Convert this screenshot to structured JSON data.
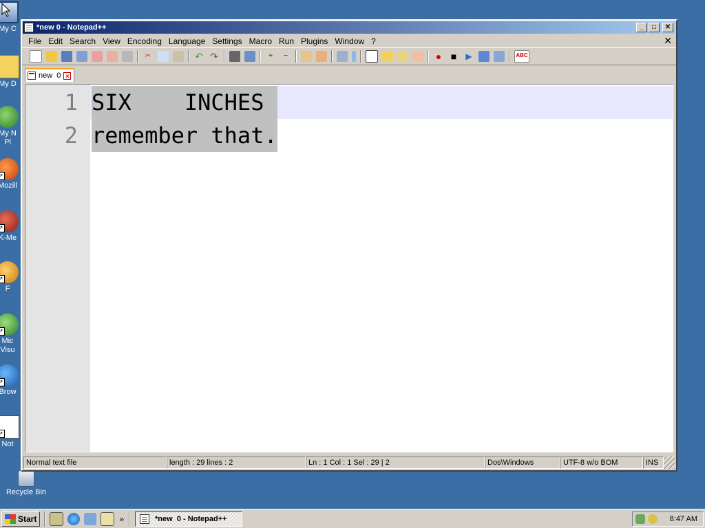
{
  "desktop": {
    "icons": [
      {
        "label": "My C",
        "icon": "my-computer-icon"
      },
      {
        "label": "My D",
        "icon": "my-documents-icon"
      },
      {
        "label": "My N\nPl",
        "icon": "network-places-icon"
      },
      {
        "label": "Mozill",
        "icon": "mozilla-icon"
      },
      {
        "label": "K-Me",
        "icon": "k-meleon-icon"
      },
      {
        "label": "F",
        "icon": "app-icon"
      },
      {
        "label": "Mic\nVisu",
        "icon": "visual-app-icon"
      },
      {
        "label": "Brow",
        "icon": "browser-icon"
      },
      {
        "label": "Not",
        "icon": "notepad-icon"
      },
      {
        "label": "Recycle Bin",
        "icon": "recycle-bin-icon"
      }
    ]
  },
  "window": {
    "title": "*new  0 - Notepad++",
    "controls": {
      "minimize": "_",
      "maximize": "□",
      "close": "✕"
    }
  },
  "menu": {
    "items": [
      "File",
      "Edit",
      "Search",
      "View",
      "Encoding",
      "Language",
      "Settings",
      "Macro",
      "Run",
      "Plugins",
      "Window",
      "?"
    ],
    "close_doc": "✕"
  },
  "toolbar": {
    "buttons": [
      "new-file",
      "open-file",
      "save",
      "save-all",
      "close",
      "close-all",
      "print",
      "cut",
      "copy",
      "paste",
      "undo",
      "redo",
      "find",
      "replace",
      "zoom-in",
      "zoom-out",
      "sync-vertical",
      "sync-horizontal",
      "word-wrap",
      "show-all-chars",
      "indent-guide",
      "user-lang",
      "doc-map",
      "function-list",
      "record-macro",
      "stop-record",
      "play-macro",
      "run-macro-multiple",
      "save-macro",
      "spell-check"
    ],
    "spell_label": "ABC"
  },
  "tab": {
    "label": "new  0",
    "close": "✕"
  },
  "editor": {
    "lines": [
      {
        "num": "1",
        "text": "SIX    INCHES "
      },
      {
        "num": "2",
        "text": "remember that."
      }
    ]
  },
  "status": {
    "type": "Normal text file",
    "length": "length : 29    lines : 2",
    "position": "Ln : 1    Col : 1    Sel : 29 | 2",
    "eol": "Dos\\Windows",
    "encoding": "UTF-8 w/o BOM",
    "mode": "INS"
  },
  "taskbar": {
    "start_label": "Start",
    "chevron": "»",
    "task_label": "*new  0 - Notepad++",
    "clock": "8:47 AM"
  },
  "colors": {
    "desktop": "#3a6ea5",
    "titlebar_start": "#0a246a",
    "titlebar_end": "#a6caf0",
    "selection": "#c0c0c0",
    "current_line": "#e8e8ff",
    "tab_accent": "#f5a623"
  }
}
